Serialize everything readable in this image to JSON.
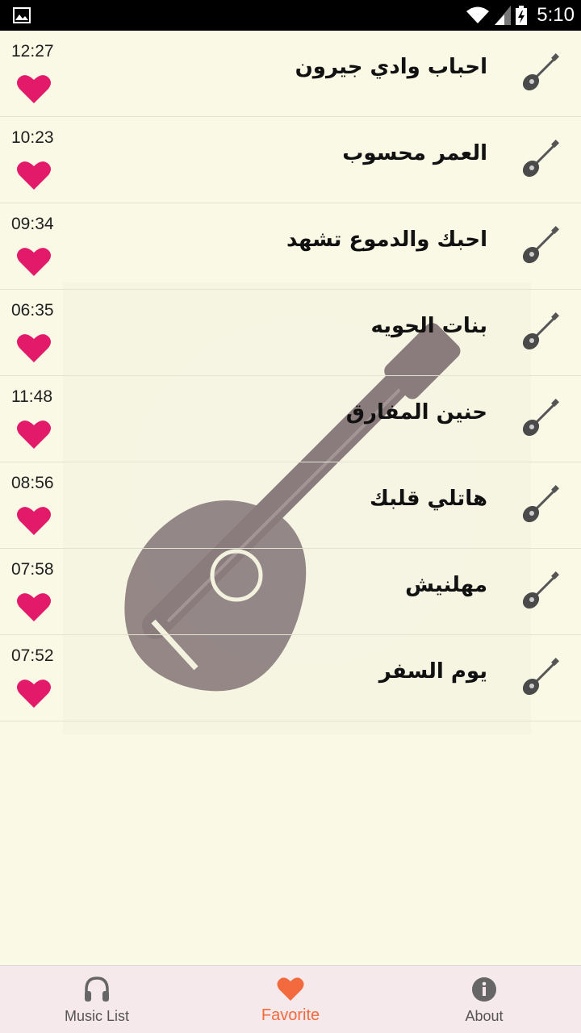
{
  "status_bar": {
    "time": "5:10"
  },
  "songs": [
    {
      "title": "احباب وادي جيرون",
      "duration": "12:27"
    },
    {
      "title": "العمر محسوب",
      "duration": "10:23"
    },
    {
      "title": "احبك والدموع تشهد",
      "duration": "09:34"
    },
    {
      "title": "بنات الحويه",
      "duration": "06:35"
    },
    {
      "title": "حنين المفارق",
      "duration": "11:48"
    },
    {
      "title": "هاتلي قلبك",
      "duration": "08:56"
    },
    {
      "title": "مهلنيش",
      "duration": "07:58"
    },
    {
      "title": "يوم السفر",
      "duration": "07:52"
    }
  ],
  "bottom_nav": {
    "items": [
      {
        "label": "Music List",
        "icon": "headphones-icon"
      },
      {
        "label": "Favorite",
        "icon": "heart-icon"
      },
      {
        "label": "About",
        "icon": "info-icon"
      }
    ],
    "active": "Favorite"
  },
  "colors": {
    "background": "#f9f9e6",
    "heart": "#e3196a",
    "accent": "#f26a3d",
    "nav_background": "#f6e9ec"
  }
}
